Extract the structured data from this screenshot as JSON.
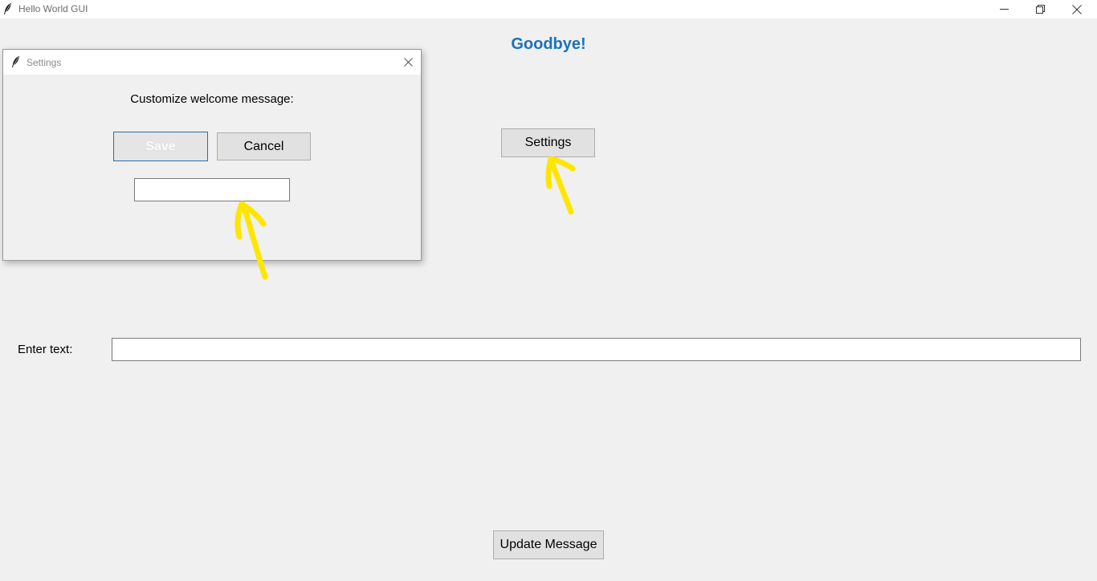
{
  "window": {
    "title": "Hello World GUI",
    "controls": [
      "minimize-icon",
      "restore-icon",
      "close-icon"
    ]
  },
  "main": {
    "greeting": "Goodbye!",
    "settings_button": "Settings",
    "input_label": "Enter text:",
    "input_value": "",
    "update_button": "Update Message",
    "greeting_color": "#1c72b8"
  },
  "dialog": {
    "title": "Settings",
    "prompt": "Customize welcome message:",
    "save_label": "Save",
    "cancel_label": "Cancel",
    "input_value": ""
  },
  "annotations": {
    "arrow_color": "#ffe600"
  }
}
